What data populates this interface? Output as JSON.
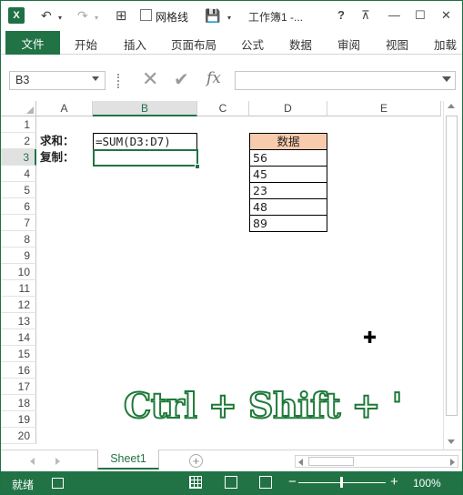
{
  "titlebar": {
    "app_icon": "X",
    "undo_icon": "undo-icon",
    "redo_icon": "redo-icon",
    "gridlines_checkbox_label": "网格线",
    "title": "工作簿1 -...",
    "help": "?",
    "minimize": "—",
    "maximize": "☐",
    "close": "✕"
  },
  "ribbon": {
    "tabs": [
      "文件",
      "开始",
      "插入",
      "页面布局",
      "公式",
      "数据",
      "审阅",
      "视图",
      "加载"
    ]
  },
  "formula_bar": {
    "name_box": "B3",
    "formula": "",
    "fx_label": "fx"
  },
  "sheet": {
    "columns": [
      "A",
      "B",
      "C",
      "D",
      "E"
    ],
    "selected_column": "B",
    "rows": [
      "1",
      "2",
      "3",
      "4",
      "5",
      "6",
      "7",
      "8",
      "9",
      "10",
      "11",
      "12",
      "13",
      "14",
      "15",
      "16",
      "17",
      "18",
      "19",
      "20"
    ],
    "selected_row": "3",
    "cells": {
      "A2": "求和：",
      "B2": "=SUM(D3:D7)",
      "A3": "复制："
    },
    "data_table": {
      "header": "数据",
      "values": [
        "56",
        "45",
        "23",
        "48",
        "89"
      ]
    },
    "overlay_text": "Ctrl + Shift + '"
  },
  "sheet_tabs": {
    "active": "Sheet1"
  },
  "statusbar": {
    "status": "就绪",
    "zoom": "100%"
  },
  "colors": {
    "excel_green": "#217346",
    "header_fill": "#f8cbad",
    "overlay_stroke": "#1f7a3a"
  }
}
